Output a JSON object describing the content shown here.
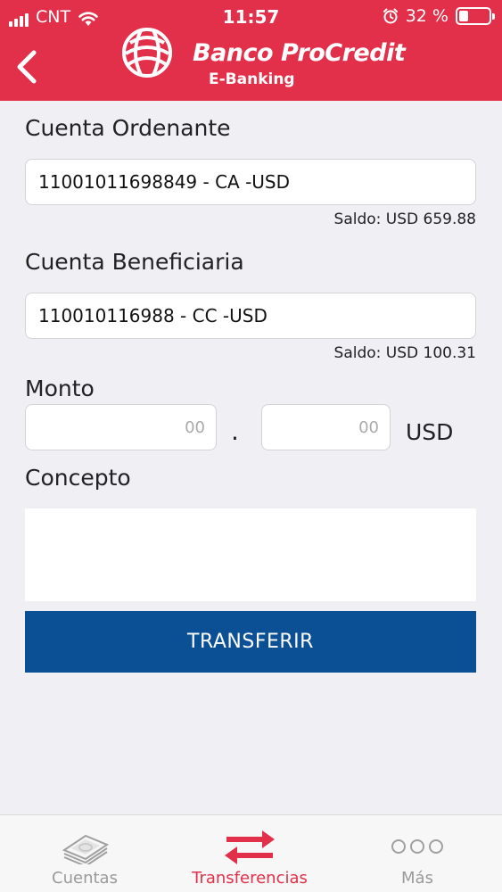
{
  "status_bar": {
    "carrier": "CNT",
    "time": "11:57",
    "battery_text": "32 %",
    "battery_level": 0.32
  },
  "header": {
    "brand": "Banco ProCredit",
    "subtitle": "E-Banking"
  },
  "form": {
    "origin_label": "Cuenta Ordenante",
    "origin_value": "11001011698849 - CA -USD",
    "origin_balance": "Saldo: USD 659.88",
    "beneficiary_label": "Cuenta Beneficiaria",
    "beneficiary_value": "110010116988 - CC -USD",
    "beneficiary_balance": "Saldo: USD 100.31",
    "amount_label": "Monto",
    "amount_integer_placeholder": "00",
    "amount_separator": ".",
    "amount_decimal_placeholder": "00",
    "currency": "USD",
    "concept_label": "Concepto",
    "submit_label": "TRANSFERIR"
  },
  "tabs": [
    {
      "label": "Cuentas",
      "icon": "banknotes-icon",
      "active": false
    },
    {
      "label": "Transferencias",
      "icon": "transfer-arrows-icon",
      "active": true
    },
    {
      "label": "Más",
      "icon": "more-dots-icon",
      "active": false
    }
  ],
  "colors": {
    "brand_red": "#e2304a",
    "button_blue": "#0b4f95",
    "inactive_gray": "#9a9a9a"
  }
}
